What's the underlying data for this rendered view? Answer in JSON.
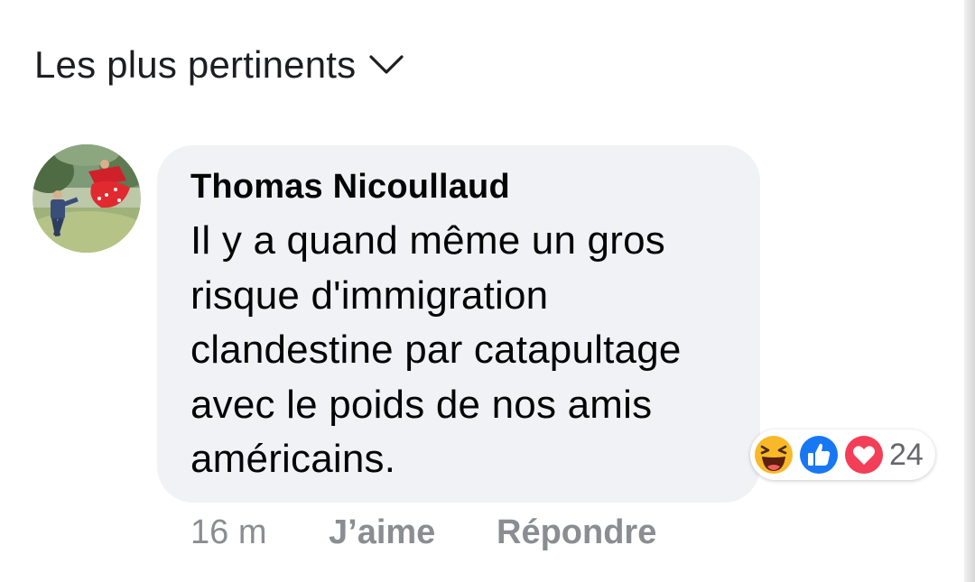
{
  "sort": {
    "label": "Les plus pertinents",
    "icon": "chevron-down-icon"
  },
  "comment": {
    "author": "Thomas Nicoullaud",
    "text": "Il y a quand même un gros risque d'immigration clandestine par catapultage avec le poids de nos amis américains.",
    "timestamp": "16 m",
    "like_label": "J’aime",
    "reply_label": "Répondre",
    "reactions": {
      "icons": [
        "haha-emoji-icon",
        "like-thumb-icon",
        "love-heart-icon"
      ],
      "count": "24"
    }
  },
  "colors": {
    "bubble": "#f0f2f5",
    "secondary_text": "#65676b",
    "like_blue": "#1877f2",
    "love_red": "#f33e58",
    "haha_yellow": "#f7b928"
  }
}
